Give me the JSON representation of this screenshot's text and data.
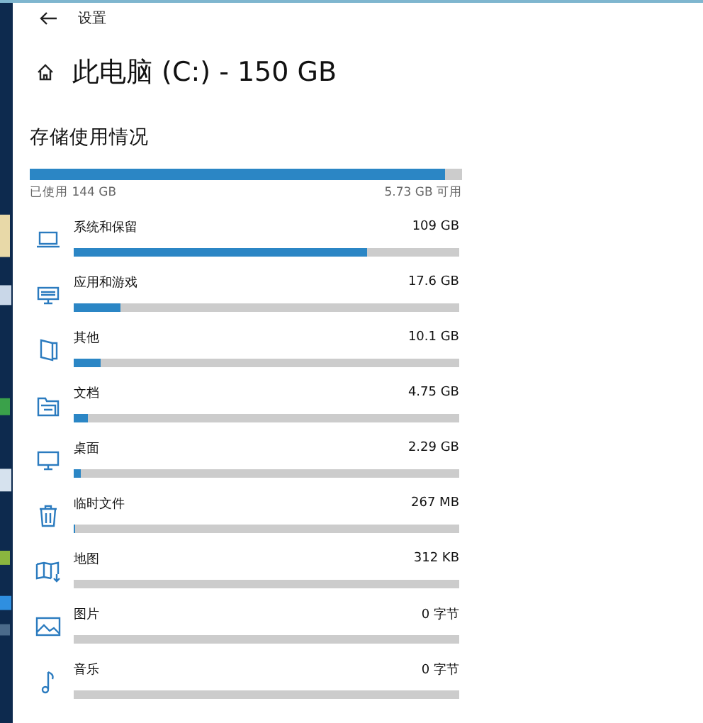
{
  "window": {
    "title": "设置"
  },
  "page": {
    "title": "此电脑 (C:) - 150 GB"
  },
  "section": {
    "title": "存储使用情况"
  },
  "overall": {
    "level": 0.96,
    "used": "已使用 144 GB",
    "free": "5.73 GB 可用"
  },
  "categories": [
    {
      "kind": "system",
      "name": "系统和保留",
      "size": "109 GB",
      "level": 0.76
    },
    {
      "kind": "apps",
      "name": "应用和游戏",
      "size": "17.6 GB",
      "level": 0.12
    },
    {
      "kind": "other",
      "name": "其他",
      "size": "10.1 GB",
      "level": 0.07
    },
    {
      "kind": "documents",
      "name": "文档",
      "size": "4.75 GB",
      "level": 0.035
    },
    {
      "kind": "desktop",
      "name": "桌面",
      "size": "2.29 GB",
      "level": 0.02
    },
    {
      "kind": "temp",
      "name": "临时文件",
      "size": "267 MB",
      "level": 0.005
    },
    {
      "kind": "maps",
      "name": "地图",
      "size": "312 KB"
    },
    {
      "kind": "pictures",
      "name": "图片",
      "size": "0 字节"
    },
    {
      "kind": "music",
      "name": "音乐",
      "size": "0 字节"
    }
  ]
}
